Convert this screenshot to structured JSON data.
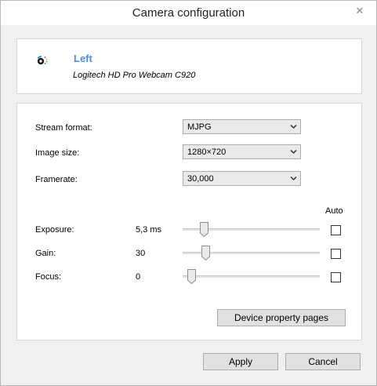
{
  "window": {
    "title": "Camera configuration",
    "close_glyph": "✕"
  },
  "device": {
    "name": "Left",
    "model": "Logitech HD Pro Webcam C920",
    "icon": "logitech-icon",
    "name_color": "#4a90d9"
  },
  "format": {
    "stream_format_label": "Stream format:",
    "stream_format_value": "MJPG",
    "image_size_label": "Image size:",
    "image_size_value": "1280×720",
    "framerate_label": "Framerate:",
    "framerate_value": "30,000"
  },
  "controls": {
    "auto_header": "Auto",
    "exposure": {
      "label": "Exposure:",
      "value": "5,3 ms",
      "slider_fraction": 0.13,
      "auto": false
    },
    "gain": {
      "label": "Gain:",
      "value": "30",
      "slider_fraction": 0.14,
      "auto": false
    },
    "focus": {
      "label": "Focus:",
      "value": "0",
      "slider_fraction": 0.03,
      "auto": false
    }
  },
  "buttons": {
    "device_property_pages": "Device property pages",
    "apply": "Apply",
    "cancel": "Cancel"
  }
}
